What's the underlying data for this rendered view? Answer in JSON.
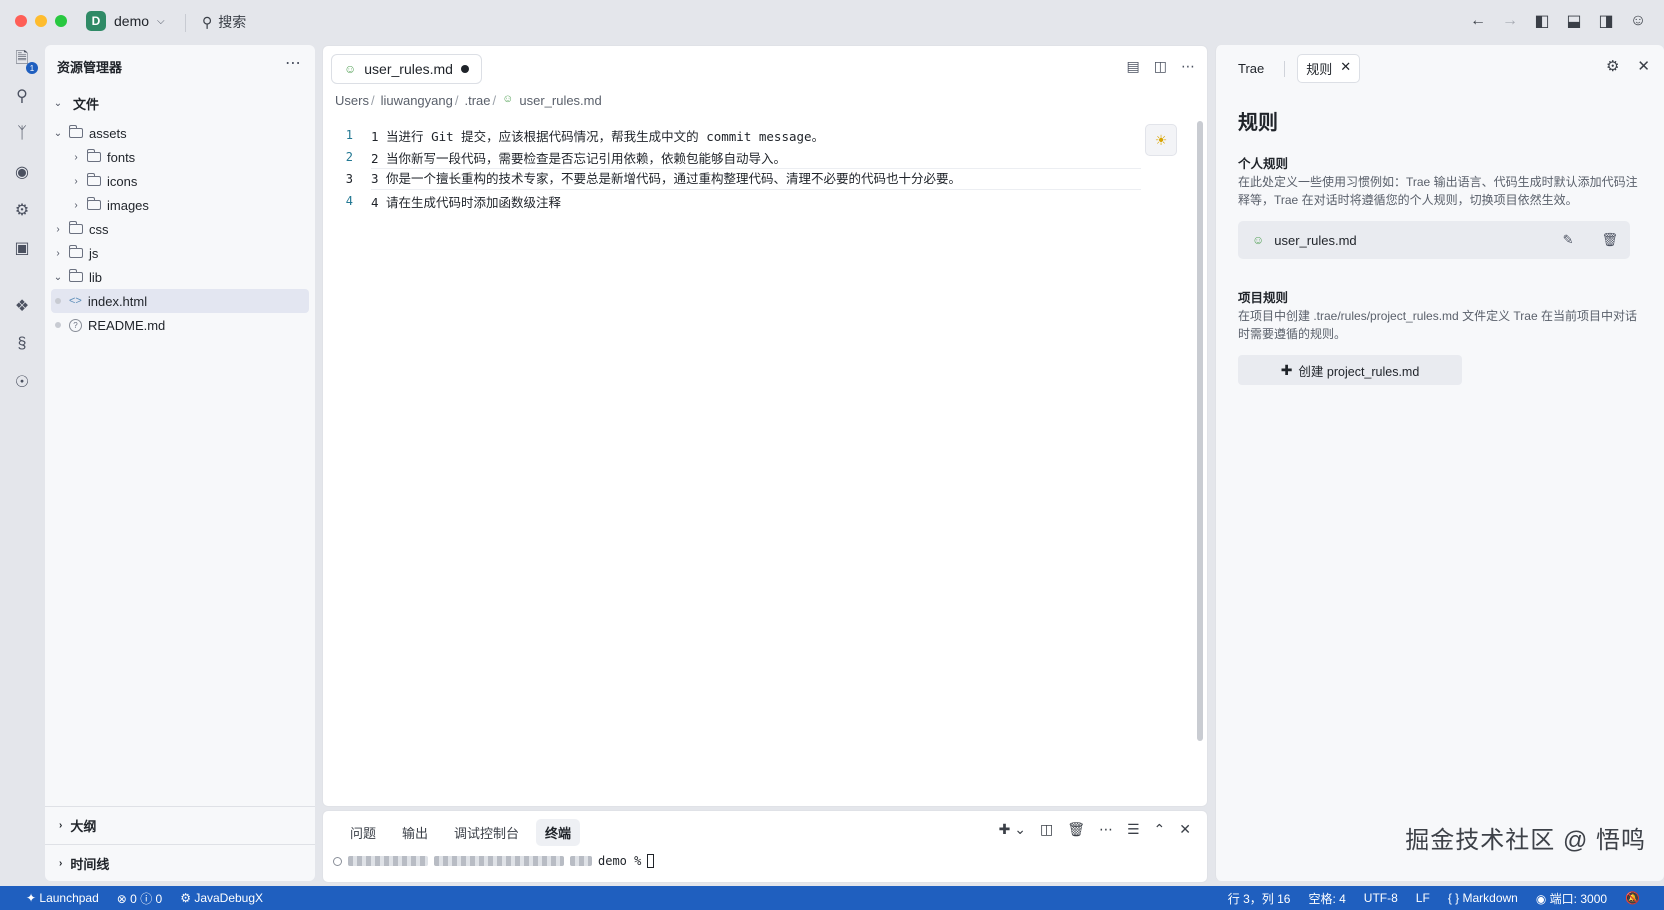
{
  "titlebar": {
    "project_badge": "D",
    "project_name": "demo",
    "search_label": "搜索"
  },
  "activity_badge": "1",
  "explorer": {
    "title": "资源管理器",
    "root": "文件",
    "items": [
      "assets",
      "fonts",
      "icons",
      "images",
      "css",
      "js",
      "lib",
      "index.html",
      "README.md"
    ],
    "sections": [
      "大纲",
      "时间线"
    ]
  },
  "editor": {
    "tab_label": "user_rules.md",
    "breadcrumb": [
      "Users",
      "liuwangyang",
      ".trae",
      "user_rules.md"
    ],
    "lines": [
      {
        "num": "1",
        "text": "1 当进行 Git 提交，应该根据代码情况，帮我生成中文的 commit message。"
      },
      {
        "num": "2",
        "text": "2 当你新写一段代码，需要检查是否忘记引用依赖，依赖包能够自动导入。"
      },
      {
        "num": "3",
        "text": "3 你是一个擅长重构的技术专家，不要总是新增代码，通过重构整理代码、清理不必要的代码也十分必要。"
      },
      {
        "num": "4",
        "text": "4 请在生成代码时添加函数级注释"
      }
    ]
  },
  "terminal": {
    "tabs": [
      "问题",
      "输出",
      "调试控制台",
      "终端"
    ],
    "prompt": "demo %"
  },
  "right_panel": {
    "tabs": [
      "Trae",
      "规则"
    ],
    "title": "规则",
    "personal_title": "个人规则",
    "personal_desc": "在此处定义一些使用习惯例如：Trae 输出语言、代码生成时默认添加代码注释等，Trae 在对话时将遵循您的个人规则，切换项目依然生效。",
    "rule_file": "user_rules.md",
    "project_title": "项目规则",
    "project_desc": "在项目中创建 .trae/rules/project_rules.md 文件定义 Trae 在当前项目中对话时需要遵循的规则。",
    "create_button": "创建 project_rules.md",
    "watermark": "掘金技术社区 @ 悟鸣"
  },
  "statusbar": {
    "launchpad": "Launchpad",
    "errors": "0",
    "warnings": "0",
    "debug": "JavaDebugX",
    "position": "行 3，列 16",
    "spaces": "空格: 4",
    "encoding": "UTF-8",
    "eol": "LF",
    "language": "Markdown",
    "port": "端口: 3000"
  }
}
